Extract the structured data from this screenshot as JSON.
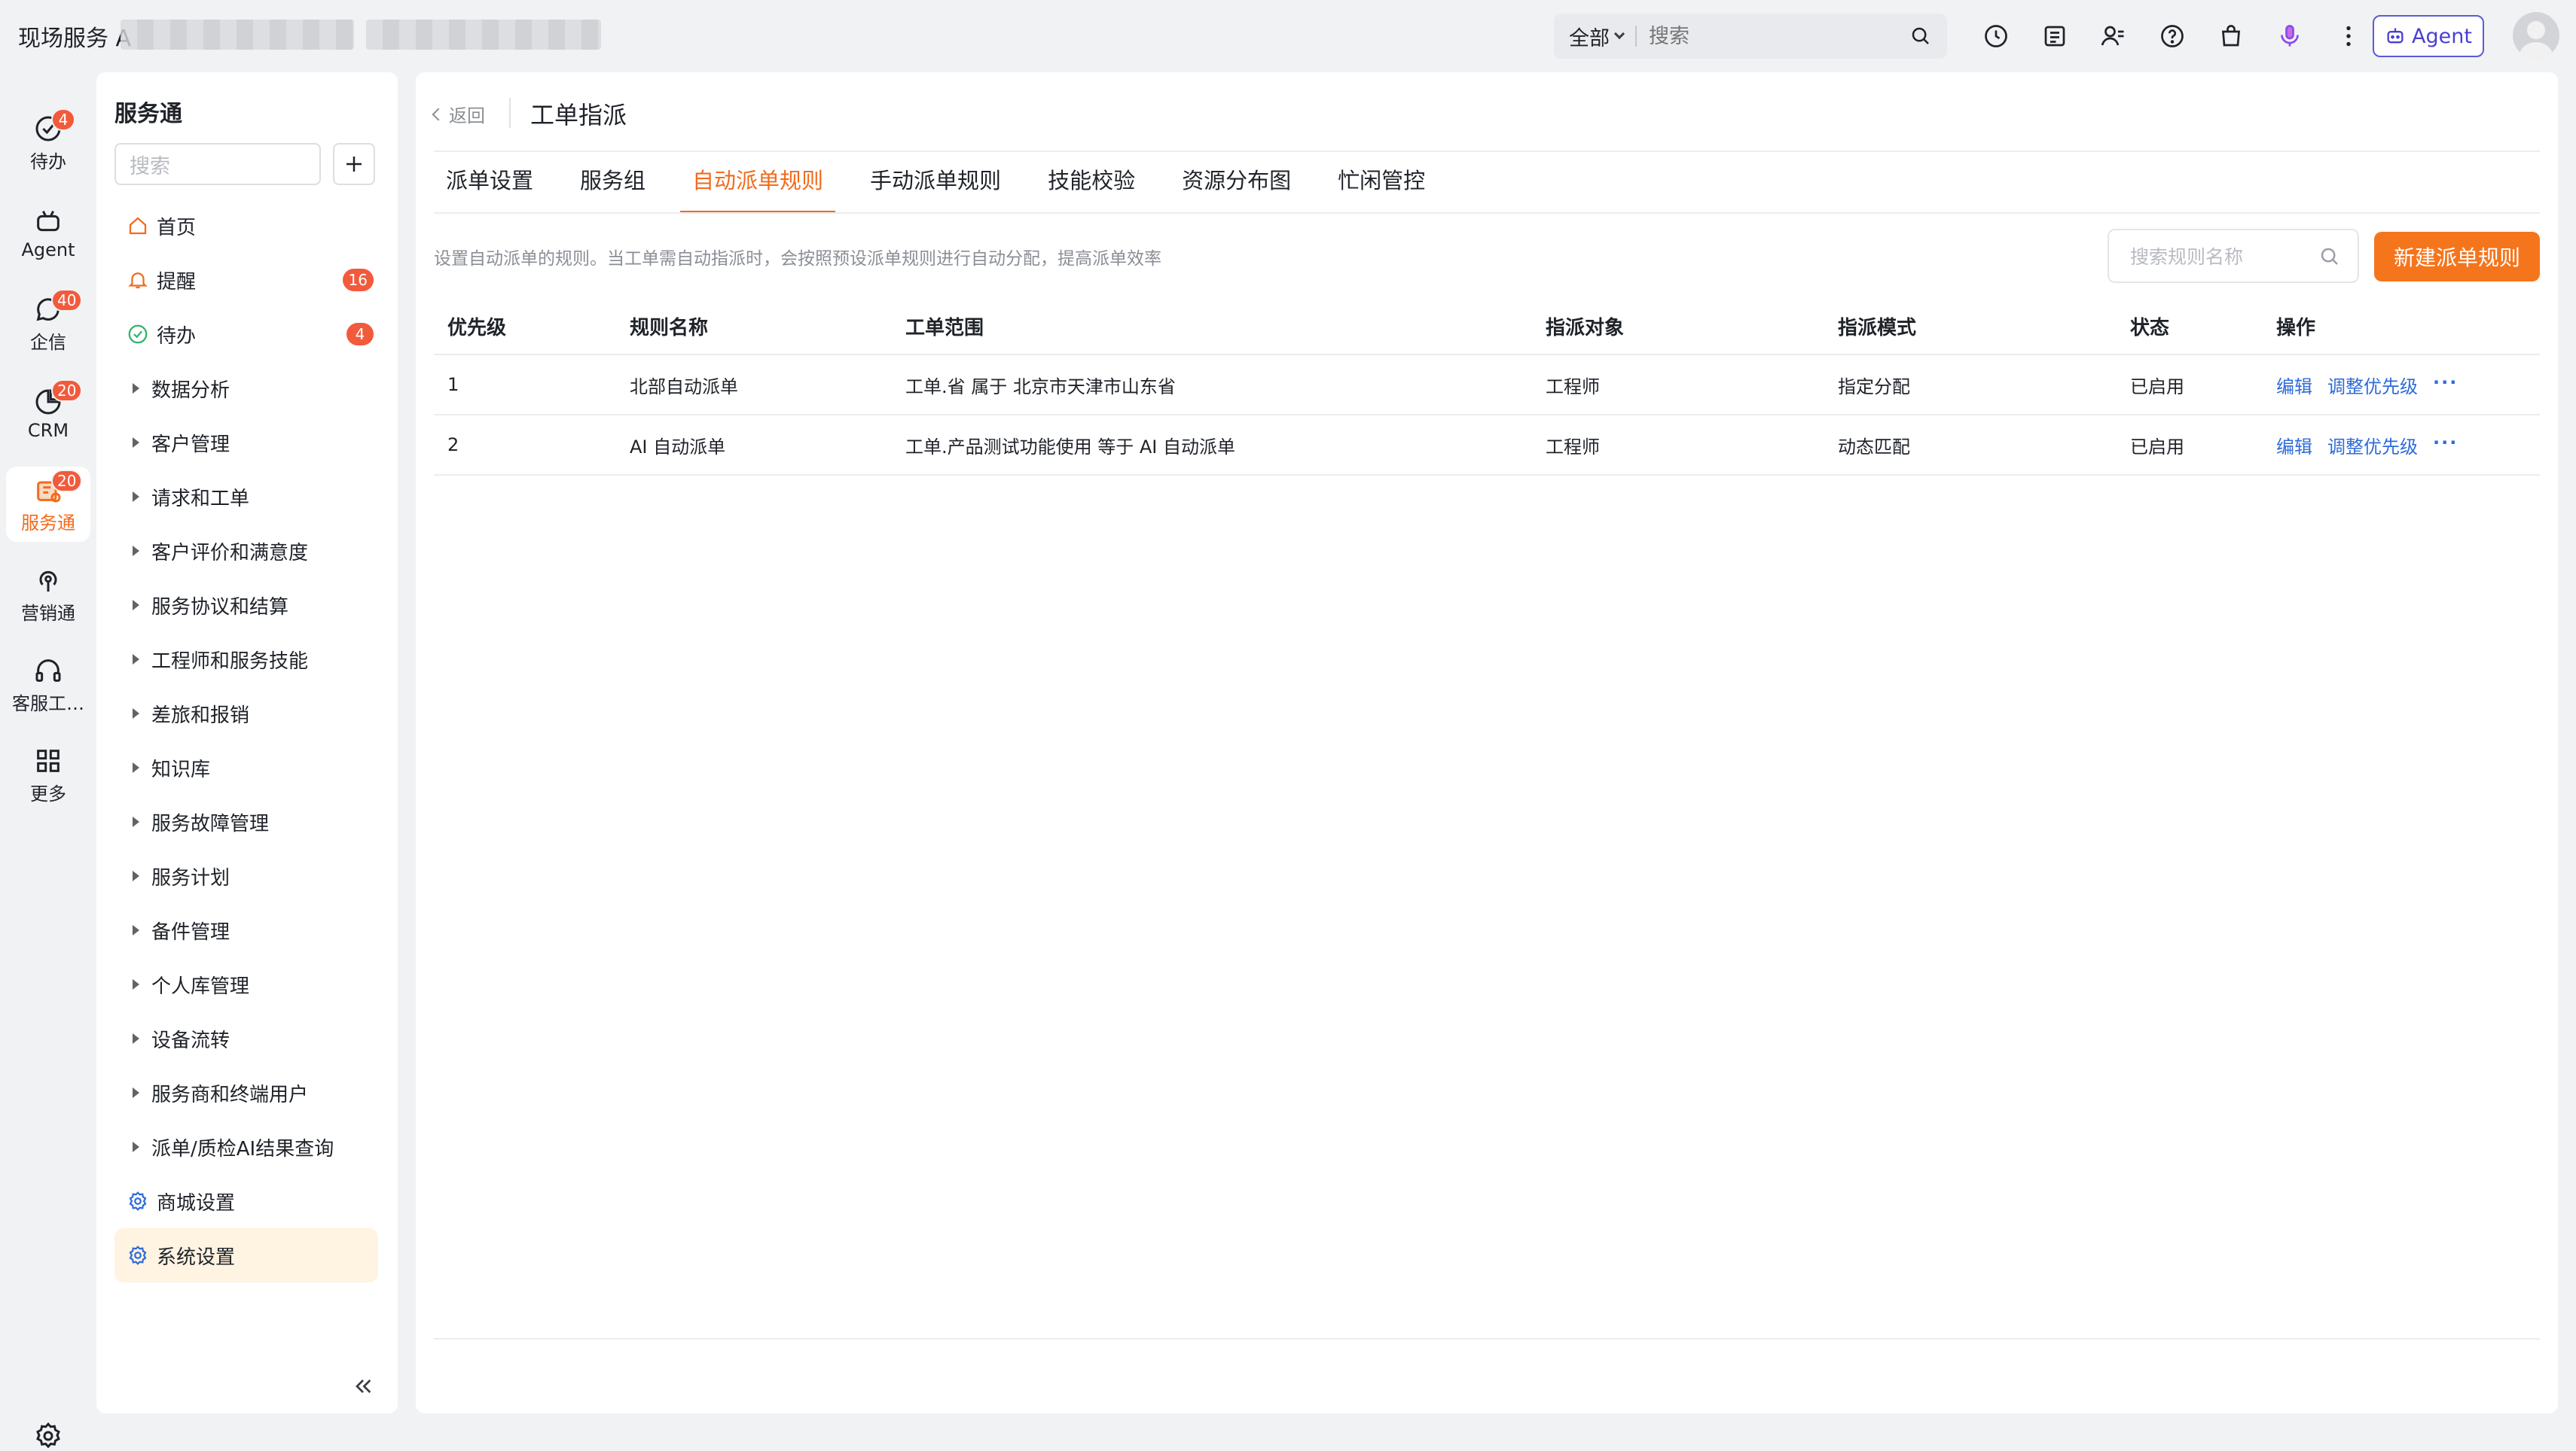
{
  "header": {
    "app_title": "现场服务 A",
    "search_scope": "全部",
    "search_placeholder": "搜索",
    "agent_label": "Agent"
  },
  "rail": {
    "items": [
      {
        "label": "待办",
        "badge": "4",
        "icon": "check-circle-icon"
      },
      {
        "label": "Agent",
        "badge": "",
        "icon": "robot-icon"
      },
      {
        "label": "企信",
        "badge": "40",
        "icon": "chat-icon"
      },
      {
        "label": "CRM",
        "badge": "20",
        "icon": "pie-chart-icon"
      },
      {
        "label": "服务通",
        "badge": "20",
        "icon": "service-icon"
      },
      {
        "label": "营销通",
        "badge": "",
        "icon": "broadcast-icon"
      },
      {
        "label": "客服工…",
        "badge": "",
        "icon": "headset-icon"
      },
      {
        "label": "更多",
        "badge": "",
        "icon": "grid-icon"
      }
    ]
  },
  "sidebar": {
    "title": "服务通",
    "search_placeholder": "搜索",
    "items": [
      {
        "label": "首页",
        "badge": ""
      },
      {
        "label": "提醒",
        "badge": "16"
      },
      {
        "label": "待办",
        "badge": "4"
      },
      {
        "label": "数据分析"
      },
      {
        "label": "客户管理"
      },
      {
        "label": "请求和工单"
      },
      {
        "label": "客户评价和满意度"
      },
      {
        "label": "服务协议和结算"
      },
      {
        "label": "工程师和服务技能"
      },
      {
        "label": "差旅和报销"
      },
      {
        "label": "知识库"
      },
      {
        "label": "服务故障管理"
      },
      {
        "label": "服务计划"
      },
      {
        "label": "备件管理"
      },
      {
        "label": "个人库管理"
      },
      {
        "label": "设备流转"
      },
      {
        "label": "服务商和终端用户"
      },
      {
        "label": "派单/质检AI结果查询"
      },
      {
        "label": "商城设置"
      },
      {
        "label": "系统设置"
      }
    ]
  },
  "main": {
    "back_label": "返回",
    "page_title": "工单指派",
    "tabs": [
      {
        "label": "派单设置"
      },
      {
        "label": "服务组"
      },
      {
        "label": "自动派单规则"
      },
      {
        "label": "手动派单规则"
      },
      {
        "label": "技能校验"
      },
      {
        "label": "资源分布图"
      },
      {
        "label": "忙闲管控"
      }
    ],
    "active_tab": "自动派单规则",
    "description": "设置自动派单的规则。当工单需自动指派时，会按照预设派单规则进行自动分配，提高派单效率",
    "rule_search_placeholder": "搜索规则名称",
    "new_button": "新建派单规则",
    "table": {
      "headers": [
        "优先级",
        "规则名称",
        "工单范围",
        "指派对象",
        "指派模式",
        "状态",
        "操作"
      ],
      "rows": [
        {
          "priority": "1",
          "name": "北部自动派单",
          "scope": "工单.省 属于 北京市天津市山东省",
          "target": "工程师",
          "mode": "指定分配",
          "status": "已启用",
          "edit": "编辑",
          "adjust": "调整优先级",
          "more": "···"
        },
        {
          "priority": "2",
          "name": "AI 自动派单",
          "scope": "工单.产品测试功能使用 等于 AI 自动派单",
          "target": "工程师",
          "mode": "动态匹配",
          "status": "已启用",
          "edit": "编辑",
          "adjust": "调整优先级",
          "more": "···"
        }
      ]
    }
  },
  "colors": {
    "accent": "#f26b1d",
    "link": "#2f6bd9",
    "badge": "#f25a3c",
    "agent": "#5b5bd6"
  }
}
